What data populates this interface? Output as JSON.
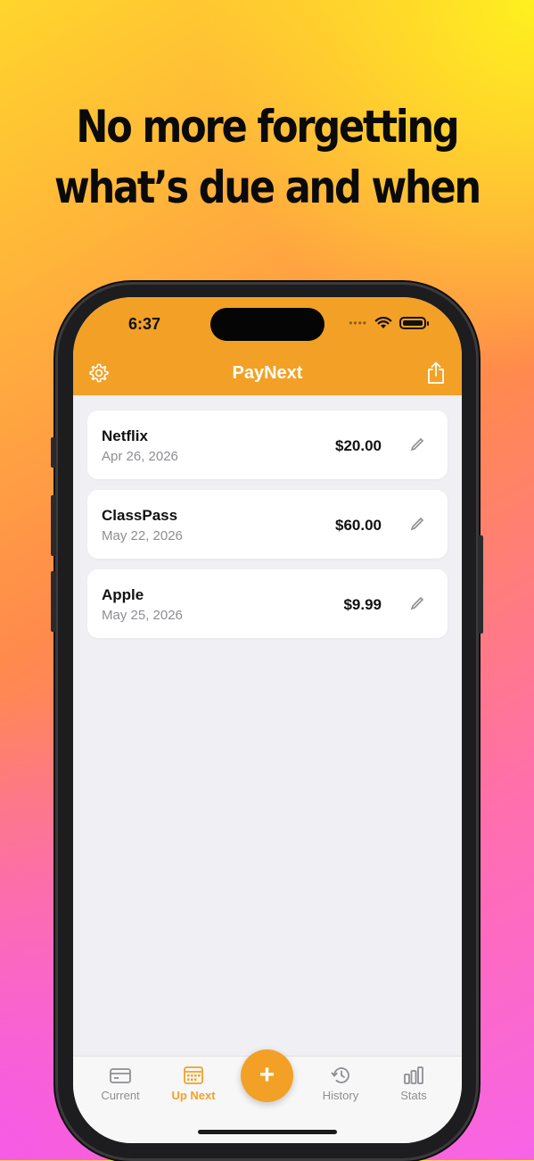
{
  "headline": {
    "line1": "No more forgetting",
    "line2": "what’s due and when"
  },
  "status_bar": {
    "time": "6:37"
  },
  "app": {
    "title": "PayNext"
  },
  "bills": [
    {
      "name": "Netflix",
      "date": "Apr 26, 2026",
      "amount": "$20.00"
    },
    {
      "name": "ClassPass",
      "date": "May 22, 2026",
      "amount": "$60.00"
    },
    {
      "name": "Apple",
      "date": "May 25, 2026",
      "amount": "$9.99"
    }
  ],
  "tabs": [
    {
      "label": "Current",
      "icon": "card-icon"
    },
    {
      "label": "Up Next",
      "icon": "calendar-icon",
      "active": true
    },
    {
      "label": "History",
      "icon": "history-icon"
    },
    {
      "label": "Stats",
      "icon": "bar-chart-icon"
    }
  ],
  "fab": {
    "label": "+"
  },
  "colors": {
    "accent": "#f2a126",
    "background": "#efeff4",
    "card": "#ffffff",
    "muted": "#8e8e93"
  }
}
